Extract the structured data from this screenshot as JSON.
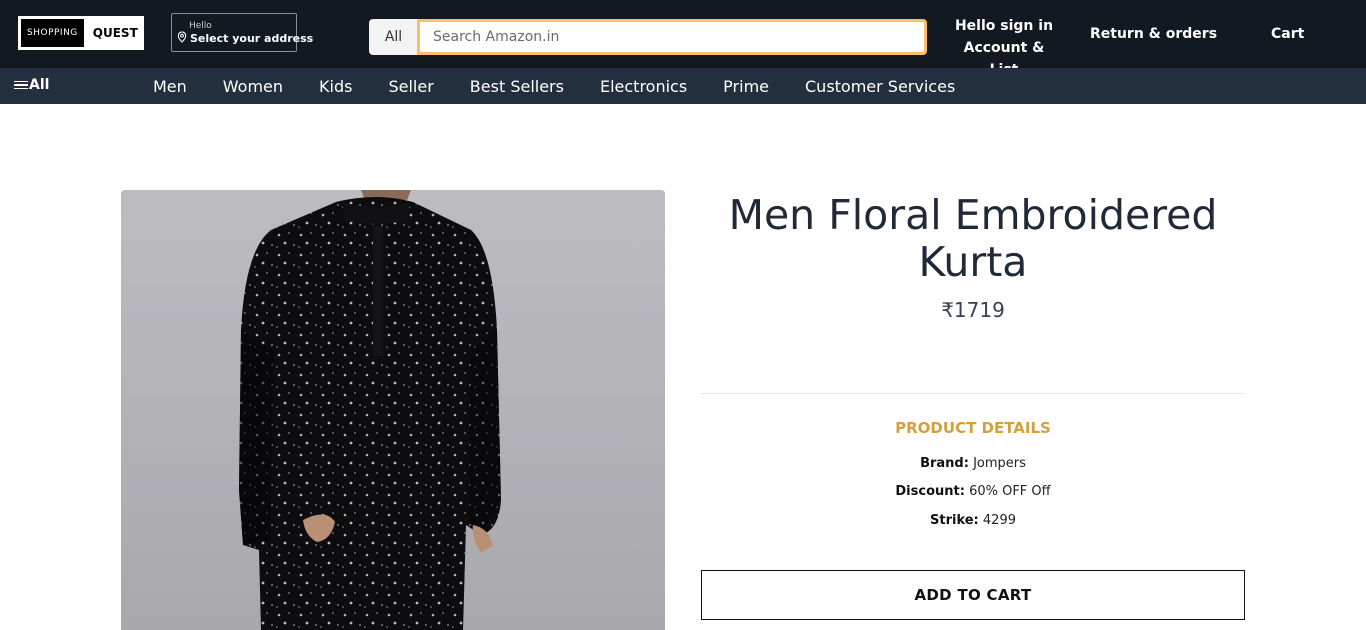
{
  "header": {
    "logo_left": "SHOPPING",
    "logo_right": "QUEST",
    "address_hello": "Hello",
    "address_select": "Select your address",
    "search_category": "All",
    "search_placeholder": "Search Amazon.in",
    "account_line1": "Hello sign in",
    "account_line2": "Account & List",
    "orders": "Return & orders",
    "cart": "Cart"
  },
  "nav": {
    "all": "All",
    "items": [
      "Men",
      "Women",
      "Kids",
      "Seller",
      "Best Sellers",
      "Electronics",
      "Prime",
      "Customer Services"
    ]
  },
  "product": {
    "title": "Men Floral Embroidered Kurta",
    "price": "₹1719",
    "details_heading": "PRODUCT DETAILS",
    "brand_label": "Brand:",
    "brand_value": "Jompers",
    "discount_label": "Discount:",
    "discount_value": "60% OFF Off",
    "strike_label": "Strike:",
    "strike_value": "4299",
    "add_to_cart": "ADD TO CART"
  },
  "colors": {
    "header_bg": "#131921",
    "nav_bg": "#232f3e",
    "search_border": "#febd69",
    "details_heading": "#d4a03f"
  }
}
